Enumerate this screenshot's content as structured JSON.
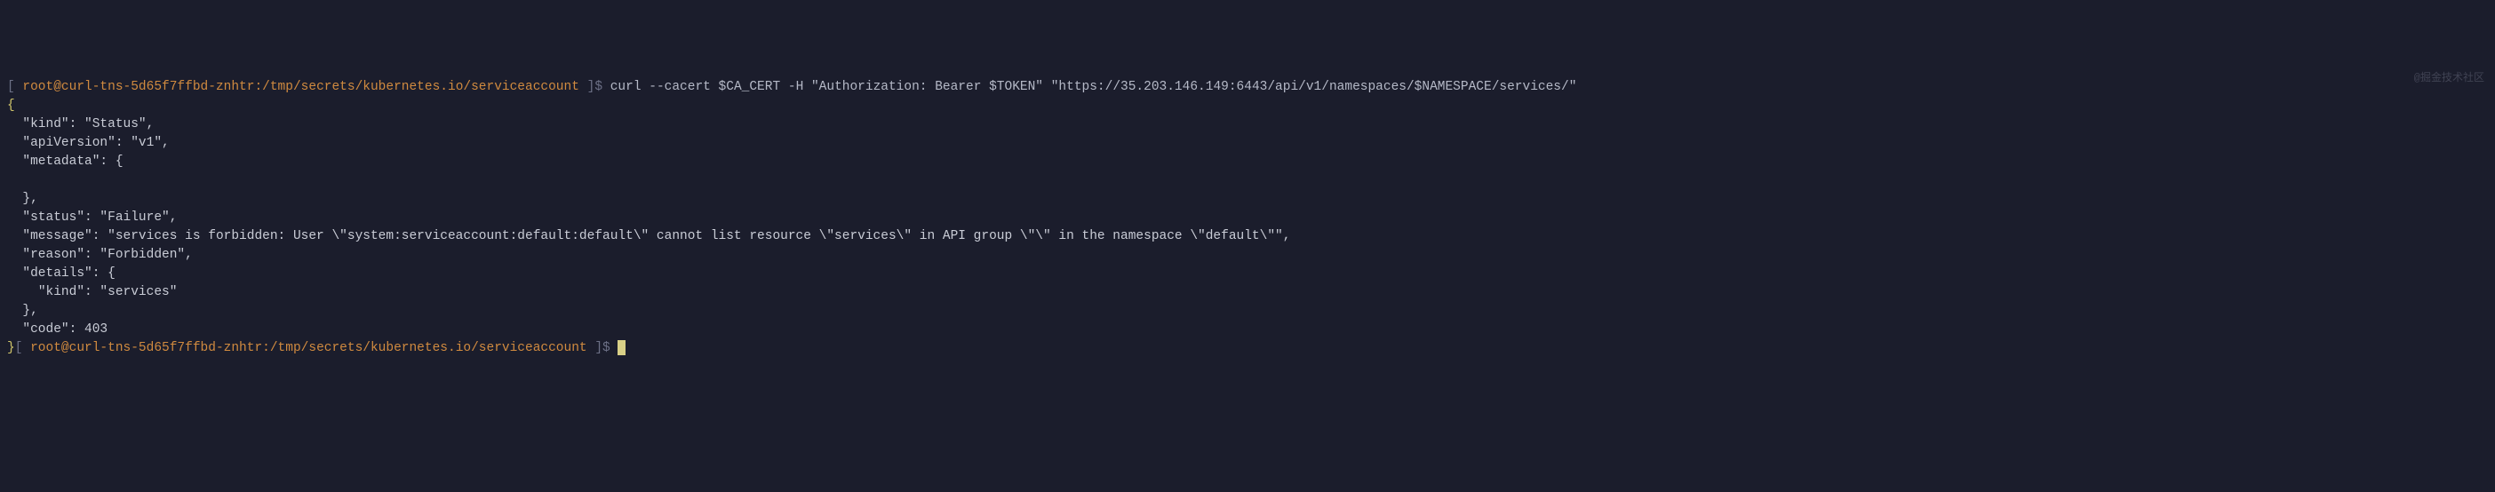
{
  "prompt1": {
    "open_bracket": "[ ",
    "user_host": "root@curl-tns-5d65f7ffbd-znhtr:",
    "path": "/tmp/secrets/kubernetes.io/serviceaccount",
    "close_bracket": " ]",
    "dollar": "$"
  },
  "command": " curl --cacert $CA_CERT -H \"Authorization: Bearer $TOKEN\" \"https://35.203.146.149:6443/api/v1/namespaces/$NAMESPACE/services/\"",
  "json_open": "{",
  "json_lines": {
    "kind": "  \"kind\": \"Status\",",
    "apiVersion": "  \"apiVersion\": \"v1\",",
    "metadata_open": "  \"metadata\": {",
    "metadata_blank": "    ",
    "metadata_close": "  },",
    "status": "  \"status\": \"Failure\",",
    "message": "  \"message\": \"services is forbidden: User \\\"system:serviceaccount:default:default\\\" cannot list resource \\\"services\\\" in API group \\\"\\\" in the namespace \\\"default\\\"\",",
    "reason": "  \"reason\": \"Forbidden\",",
    "details_open": "  \"details\": {",
    "details_kind": "    \"kind\": \"services\"",
    "details_close": "  },",
    "code": "  \"code\": 403"
  },
  "json_close": "}",
  "prompt2": {
    "open_bracket": "[ ",
    "user_host": "root@curl-tns-5d65f7ffbd-znhtr:",
    "path": "/tmp/secrets/kubernetes.io/serviceaccount",
    "close_bracket": " ]",
    "dollar": "$"
  },
  "watermark": "@掘金技术社区"
}
